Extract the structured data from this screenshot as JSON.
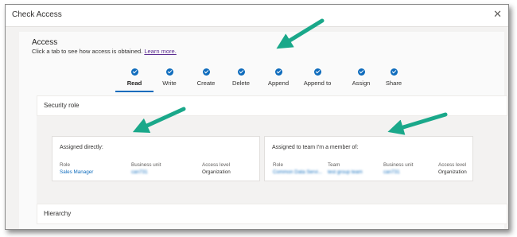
{
  "dialog": {
    "title": "Check Access",
    "close_glyph": "✕"
  },
  "access": {
    "heading": "Access",
    "subtitle_text": "Click a tab to see how access is obtained.",
    "learn_more": "Learn more."
  },
  "tabs": [
    {
      "label": "Read",
      "active": true
    },
    {
      "label": "Write",
      "active": false
    },
    {
      "label": "Create",
      "active": false
    },
    {
      "label": "Delete",
      "active": false
    },
    {
      "label": "Append",
      "active": false
    },
    {
      "label": "Append to",
      "active": false
    },
    {
      "label": "Assign",
      "active": false
    },
    {
      "label": "Share",
      "active": false
    }
  ],
  "security_role": {
    "title": "Security role",
    "assigned_directly": {
      "title": "Assigned directly:",
      "role_header": "Role",
      "role_value": "Sales Manager",
      "bu_header": "Business unit",
      "bu_value": "can731",
      "al_header": "Access level",
      "al_value": "Organization"
    },
    "team": {
      "title": "Assigned to team I'm a member of:",
      "role_header": "Role",
      "role_value": "Common Data Servi...",
      "team_header": "Team",
      "team_value": "test group team",
      "bu_header": "Business unit",
      "bu_value": "can731",
      "al_header": "Access level",
      "al_value": "Organization"
    }
  },
  "hierarchy": {
    "title": "Hierarchy"
  },
  "colors": {
    "accent": "#0f6cbd",
    "arrow": "#1aa88a",
    "link_visited": "#5c2d91"
  }
}
